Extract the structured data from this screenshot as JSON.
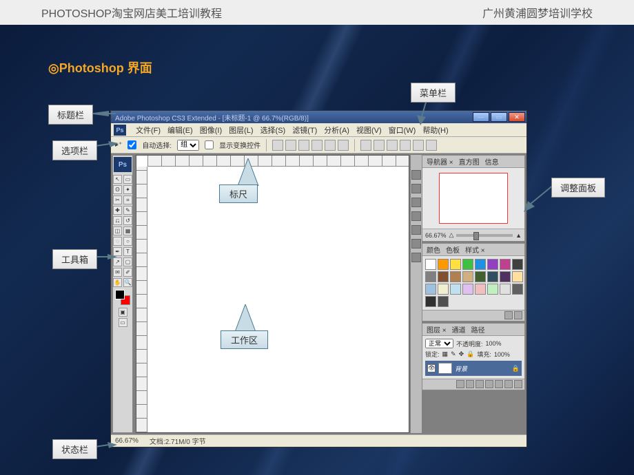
{
  "topbar": {
    "left": "PHOTOSHOP淘宝网店美工培训教程",
    "right": "广州黄浦圆梦培训学校"
  },
  "section_title": "◎Photoshop 界面",
  "callouts": {
    "title_bar": "标题栏",
    "menu_bar": "菜单栏",
    "options_bar": "选项栏",
    "toolbox": "工具箱",
    "ruler": "标尺",
    "work_area": "工作区",
    "status_bar": "状态栏",
    "adjust_panel": "调整面板"
  },
  "ps": {
    "title": "Adobe Photoshop CS3 Extended - [未标题-1 @ 66.7%(RGB/8)]",
    "menu": {
      "file": "文件(F)",
      "edit": "编辑(E)",
      "image": "图像(I)",
      "layer": "图层(L)",
      "select": "选择(S)",
      "filter": "滤镜(T)",
      "analysis": "分析(A)",
      "view": "视图(V)",
      "window": "窗口(W)",
      "help": "帮助(H)"
    },
    "options": {
      "auto_select": "自动选择:",
      "group": "组",
      "show_transform": "显示变换控件"
    },
    "panels": {
      "navigator_tabs": {
        "nav": "导航器 ×",
        "hist": "直方图",
        "info": "信息"
      },
      "zoom": "66.67%",
      "swatch_tabs": {
        "color": "颜色",
        "swatches": "色板",
        "styles": "样式 ×"
      },
      "layer_tabs": {
        "layers": "图层 ×",
        "channels": "通道",
        "paths": "路径"
      },
      "blend_mode": "正常",
      "opacity_label": "不透明度:",
      "opacity_value": "100%",
      "lock_label": "锁定:",
      "fill_label": "填充:",
      "fill_value": "100%",
      "layer_name": "背景"
    },
    "swatches": [
      "#ffffff",
      "#ff9900",
      "#ffe040",
      "#40c040",
      "#2090e0",
      "#9040c0",
      "#c04090",
      "#404040",
      "#808080",
      "#805030",
      "#b08050",
      "#d0b080",
      "#406030",
      "#305060",
      "#503060",
      "#ffe0a0",
      "#a0c0e0",
      "#f0f0d0",
      "#c0e0f0",
      "#e0c0f0",
      "#f0c0c0",
      "#c0f0c0",
      "#e0e0e0",
      "#606060",
      "#303030",
      "#505050"
    ],
    "status": {
      "zoom": "66.67%",
      "doc": "文档:2.71M/0 字节"
    }
  }
}
